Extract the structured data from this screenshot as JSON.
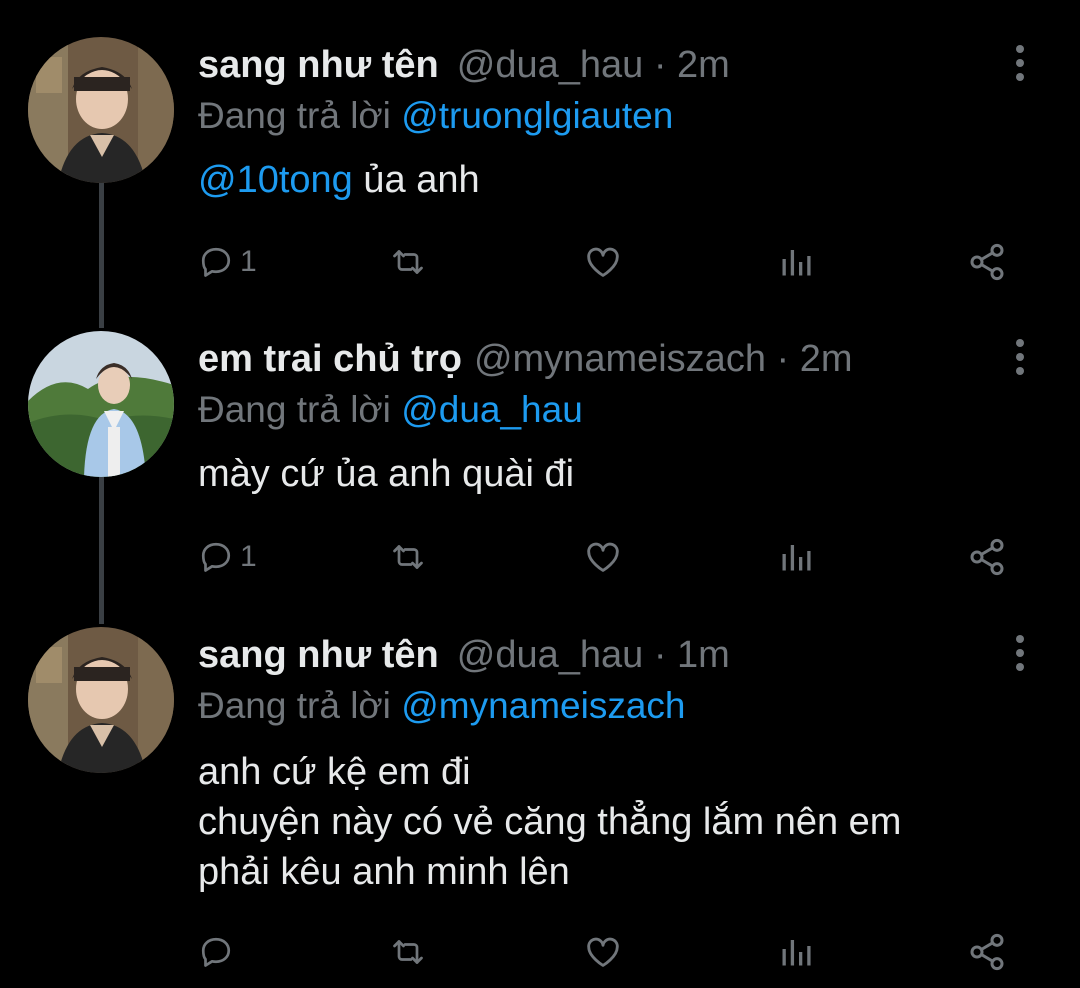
{
  "tweets": [
    {
      "name": "sang như tên",
      "handle": "@dua_hau",
      "dot": "·",
      "time": "2m",
      "reply_prefix": "Đang trả lời",
      "reply_to": "@truonglgiauten",
      "text_mention": "@10tong",
      "text_lines": [
        " ủa anh"
      ],
      "reply_count": "1"
    },
    {
      "name": "em trai chủ trọ",
      "handle": "@mynameiszach",
      "dot": "·",
      "time": "2m",
      "reply_prefix": "Đang trả lời",
      "reply_to": "@dua_hau",
      "text_lines": [
        "mày cứ ủa anh quài đi"
      ],
      "reply_count": "1"
    },
    {
      "name": "sang như tên",
      "handle": "@dua_hau",
      "dot": "·",
      "time": "1m",
      "reply_prefix": "Đang trả lời",
      "reply_to": "@mynameiszach",
      "text_lines": [
        "anh cứ kệ em đi",
        "chuyện này có vẻ căng thẳng lắm nên em",
        "phải kêu anh minh lên"
      ],
      "reply_count": ""
    }
  ],
  "icons": {
    "reply": "reply-icon",
    "retweet": "retweet-icon",
    "like": "heart-icon",
    "views": "analytics-icon",
    "share": "share-icon",
    "more": "more-vertical-icon"
  },
  "colors": {
    "background": "#000000",
    "text": "#e7e9ea",
    "secondary": "#71767b",
    "accent": "#1d9bf0",
    "thread_line": "#3a3f44"
  }
}
